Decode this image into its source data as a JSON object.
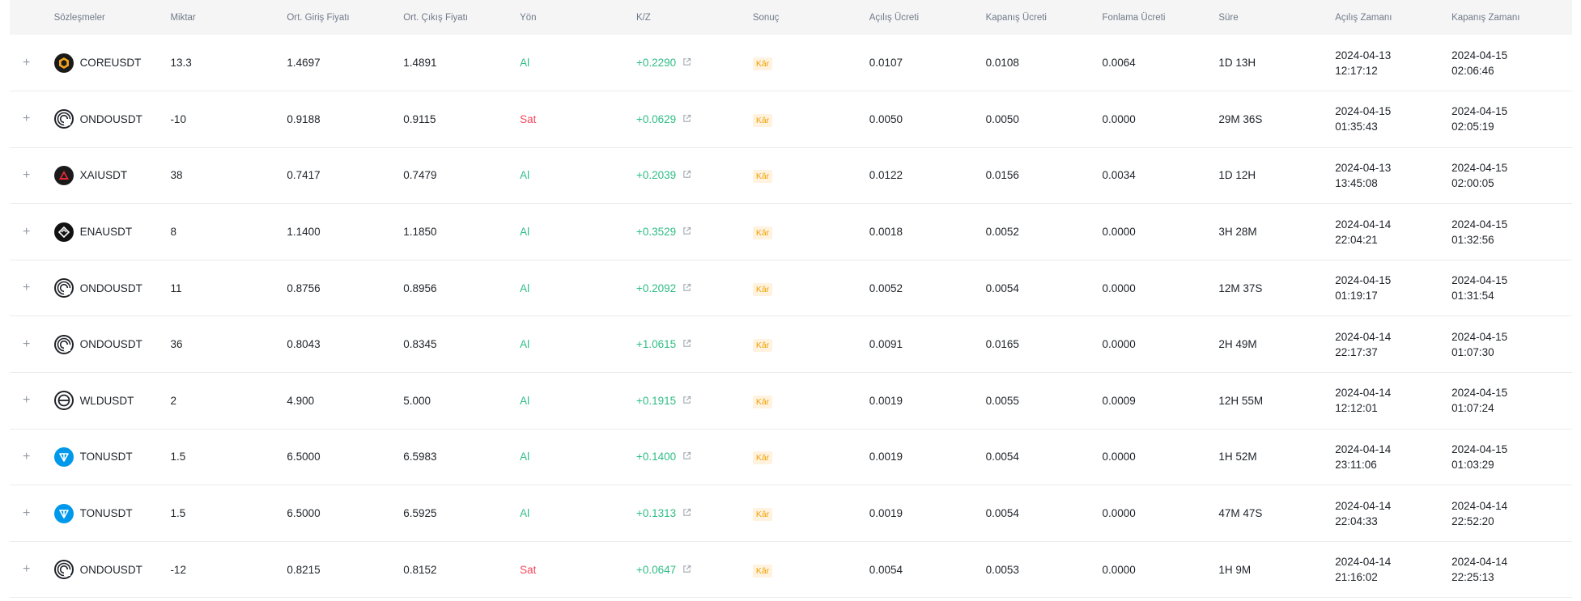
{
  "headers": [
    "Sözleşmeler",
    "Miktar",
    "Ort. Giriş Fiyatı",
    "Ort. Çıkış Fiyatı",
    "Yön",
    "K/Z",
    "Sonuç",
    "Açılış Ücreti",
    "Kapanış Ücreti",
    "Fonlama Ücreti",
    "Süre",
    "Açılış Zamanı",
    "Kapanış Zamanı"
  ],
  "expand_symbol": "+",
  "colors": {
    "buy": "#2ebd85",
    "sell": "#f6465d",
    "profit_badge_bg": "#fff3e0",
    "profit_badge_text": "#f0a000"
  },
  "rows": [
    {
      "symbol": "COREUSDT",
      "icon": "core-coin-icon",
      "qty": "13.3",
      "entry": "1.4697",
      "exit": "1.4891",
      "side": "Al",
      "pnl": "+0.2290",
      "result": "Kâr",
      "open_fee": "0.0107",
      "close_fee": "0.0108",
      "funding_fee": "0.0064",
      "duration": "1D 13H",
      "open_date": "2024-04-13",
      "open_time": "12:17:12",
      "close_date": "2024-04-15",
      "close_time": "02:06:46"
    },
    {
      "symbol": "ONDOUSDT",
      "icon": "ondo-coin-icon",
      "qty": "-10",
      "entry": "0.9188",
      "exit": "0.9115",
      "side": "Sat",
      "pnl": "+0.0629",
      "result": "Kâr",
      "open_fee": "0.0050",
      "close_fee": "0.0050",
      "funding_fee": "0.0000",
      "duration": "29M 36S",
      "open_date": "2024-04-15",
      "open_time": "01:35:43",
      "close_date": "2024-04-15",
      "close_time": "02:05:19"
    },
    {
      "symbol": "XAIUSDT",
      "icon": "xai-coin-icon",
      "qty": "38",
      "entry": "0.7417",
      "exit": "0.7479",
      "side": "Al",
      "pnl": "+0.2039",
      "result": "Kâr",
      "open_fee": "0.0122",
      "close_fee": "0.0156",
      "funding_fee": "0.0034",
      "duration": "1D 12H",
      "open_date": "2024-04-13",
      "open_time": "13:45:08",
      "close_date": "2024-04-15",
      "close_time": "02:00:05"
    },
    {
      "symbol": "ENAUSDT",
      "icon": "ena-coin-icon",
      "qty": "8",
      "entry": "1.1400",
      "exit": "1.1850",
      "side": "Al",
      "pnl": "+0.3529",
      "result": "Kâr",
      "open_fee": "0.0018",
      "close_fee": "0.0052",
      "funding_fee": "0.0000",
      "duration": "3H 28M",
      "open_date": "2024-04-14",
      "open_time": "22:04:21",
      "close_date": "2024-04-15",
      "close_time": "01:32:56"
    },
    {
      "symbol": "ONDOUSDT",
      "icon": "ondo-coin-icon",
      "qty": "11",
      "entry": "0.8756",
      "exit": "0.8956",
      "side": "Al",
      "pnl": "+0.2092",
      "result": "Kâr",
      "open_fee": "0.0052",
      "close_fee": "0.0054",
      "funding_fee": "0.0000",
      "duration": "12M 37S",
      "open_date": "2024-04-15",
      "open_time": "01:19:17",
      "close_date": "2024-04-15",
      "close_time": "01:31:54"
    },
    {
      "symbol": "ONDOUSDT",
      "icon": "ondo-coin-icon",
      "qty": "36",
      "entry": "0.8043",
      "exit": "0.8345",
      "side": "Al",
      "pnl": "+1.0615",
      "result": "Kâr",
      "open_fee": "0.0091",
      "close_fee": "0.0165",
      "funding_fee": "0.0000",
      "duration": "2H 49M",
      "open_date": "2024-04-14",
      "open_time": "22:17:37",
      "close_date": "2024-04-15",
      "close_time": "01:07:30"
    },
    {
      "symbol": "WLDUSDT",
      "icon": "wld-coin-icon",
      "qty": "2",
      "entry": "4.900",
      "exit": "5.000",
      "side": "Al",
      "pnl": "+0.1915",
      "result": "Kâr",
      "open_fee": "0.0019",
      "close_fee": "0.0055",
      "funding_fee": "0.0009",
      "duration": "12H 55M",
      "open_date": "2024-04-14",
      "open_time": "12:12:01",
      "close_date": "2024-04-15",
      "close_time": "01:07:24"
    },
    {
      "symbol": "TONUSDT",
      "icon": "ton-coin-icon",
      "qty": "1.5",
      "entry": "6.5000",
      "exit": "6.5983",
      "side": "Al",
      "pnl": "+0.1400",
      "result": "Kâr",
      "open_fee": "0.0019",
      "close_fee": "0.0054",
      "funding_fee": "0.0000",
      "duration": "1H 52M",
      "open_date": "2024-04-14",
      "open_time": "23:11:06",
      "close_date": "2024-04-15",
      "close_time": "01:03:29"
    },
    {
      "symbol": "TONUSDT",
      "icon": "ton-coin-icon",
      "qty": "1.5",
      "entry": "6.5000",
      "exit": "6.5925",
      "side": "Al",
      "pnl": "+0.1313",
      "result": "Kâr",
      "open_fee": "0.0019",
      "close_fee": "0.0054",
      "funding_fee": "0.0000",
      "duration": "47M 47S",
      "open_date": "2024-04-14",
      "open_time": "22:04:33",
      "close_date": "2024-04-14",
      "close_time": "22:52:20"
    },
    {
      "symbol": "ONDOUSDT",
      "icon": "ondo-coin-icon",
      "qty": "-12",
      "entry": "0.8215",
      "exit": "0.8152",
      "side": "Sat",
      "pnl": "+0.0647",
      "result": "Kâr",
      "open_fee": "0.0054",
      "close_fee": "0.0053",
      "funding_fee": "0.0000",
      "duration": "1H 9M",
      "open_date": "2024-04-14",
      "open_time": "21:16:02",
      "close_date": "2024-04-14",
      "close_time": "22:25:13"
    }
  ]
}
